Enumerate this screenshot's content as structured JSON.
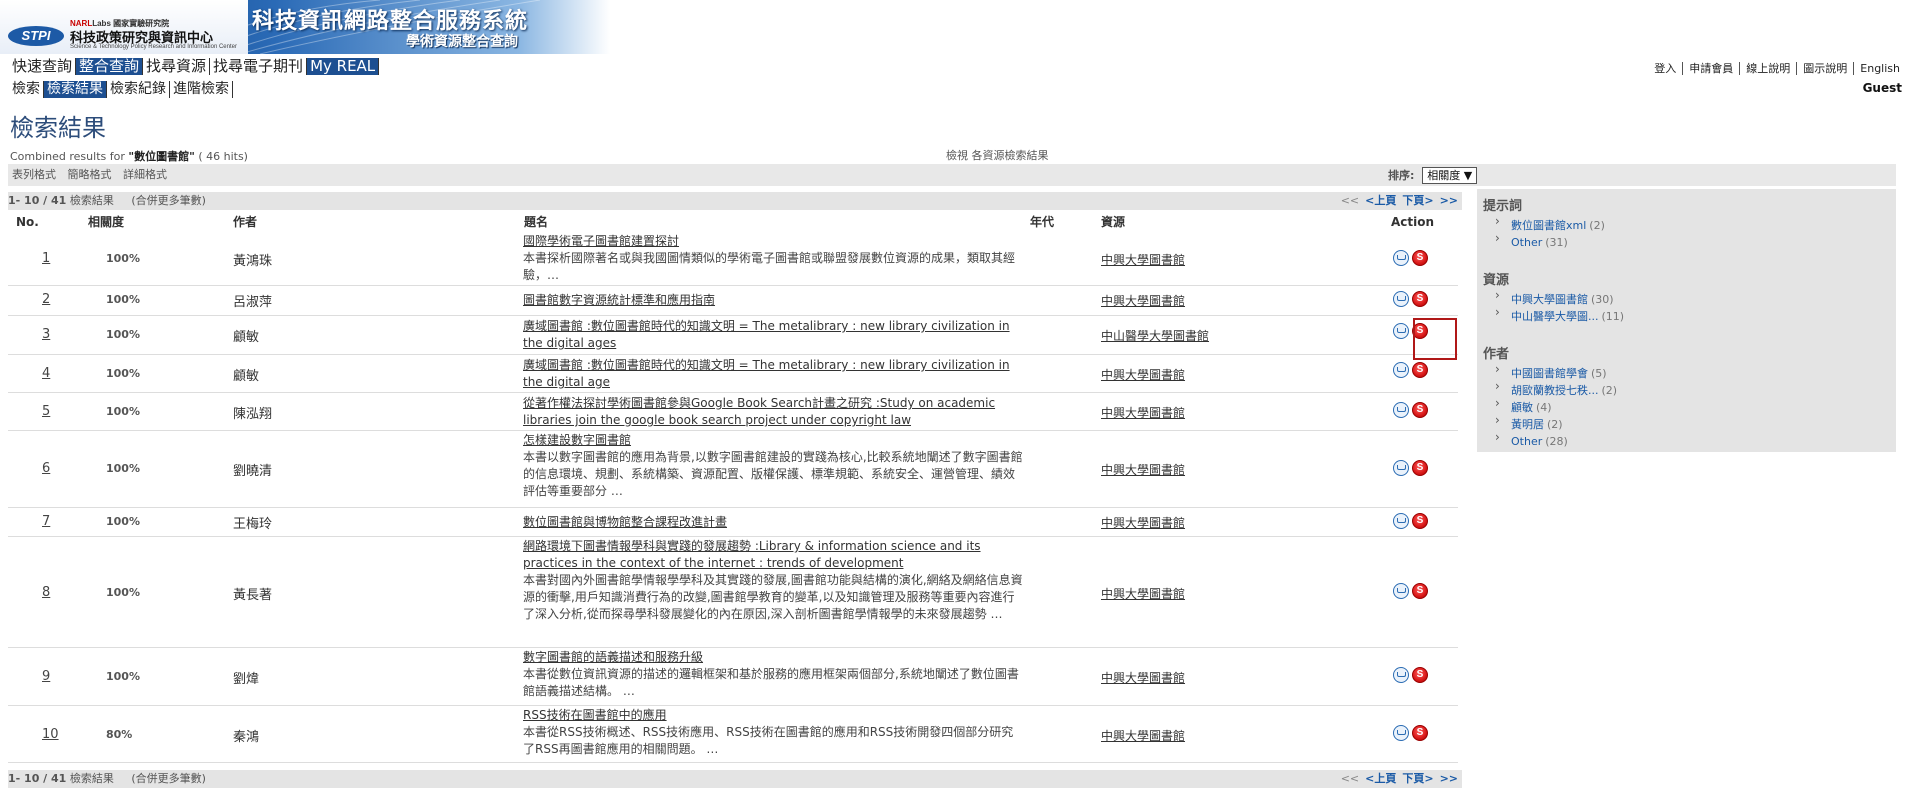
{
  "banner": {
    "narl_prefix": "NARL",
    "narl_suffix": "Labs 國家實驗研究院",
    "logo_text": "STPI",
    "institute_name": "科技政策研究與資訊中心",
    "institute_en": "Science & Technology Policy Research and Information Center",
    "title": "科技資訊網路整合服務系統",
    "subtitle": "學術資源整合查詢"
  },
  "nav_primary": [
    {
      "label": "快速查詢",
      "active": false
    },
    {
      "label": "整合查詢",
      "active": true
    },
    {
      "label": "找尋資源",
      "active": false
    },
    {
      "label": "找尋電子期刊",
      "active": false
    },
    {
      "label": "My REAL",
      "active": true
    }
  ],
  "nav_secondary": [
    {
      "label": "檢索",
      "active": false
    },
    {
      "label": "檢索結果",
      "active": true
    },
    {
      "label": "檢索紀錄",
      "active": false
    },
    {
      "label": "進階檢索",
      "active": false
    }
  ],
  "top_links": [
    "登入",
    "申請會員",
    "線上說明",
    "圖示說明",
    "English"
  ],
  "user": "Guest",
  "page_title": "檢索結果",
  "combined": {
    "prefix": "Combined results for ",
    "query": "\"數位圖書館\"",
    "hits": " ( 46 hits)"
  },
  "view_all": {
    "label": "檢視 ",
    "link": "各資源檢索結果"
  },
  "formats": [
    "表列格式",
    "簡略格式",
    "詳細格式"
  ],
  "sort": {
    "label": "排序:",
    "value": "相關度 ▼"
  },
  "pager": {
    "count": "1- 10 / 41",
    "label": " 檢索結果",
    "more": "合併更多筆數",
    "first": "<<",
    "prev": "<上頁",
    "next": "下頁>",
    "last": ">>"
  },
  "columns": {
    "no": "No.",
    "relevance": "相關度",
    "author": "作者",
    "title": "題名",
    "year": "年代",
    "source": "資源",
    "action": "Action"
  },
  "results": [
    {
      "no": "1",
      "rel": "100%",
      "author": "黃鴻珠",
      "title": "國際學術電子圖書館建置探討",
      "desc": "本書探析國際著名或與我國圖情類似的學術電子圖書館或聯盟發展數位資源的成果，類取其經驗，…",
      "source": "中興大學圖書館"
    },
    {
      "no": "2",
      "rel": "100%",
      "author": "呂淑萍",
      "title": "圖書館數字資源統計標準和應用指南",
      "desc": "",
      "source": "中興大學圖書館"
    },
    {
      "no": "3",
      "rel": "100%",
      "author": "顧敏",
      "title": "廣域圖書館 :數位圖書館時代的知識文明 = The metalibrary : new library civilization in the digital ages",
      "desc": "",
      "source": "中山醫學大學圖書館"
    },
    {
      "no": "4",
      "rel": "100%",
      "author": "顧敏",
      "title": "廣域圖書館 :數位圖書館時代的知識文明 = The metalibrary : new library civilization in the digital age",
      "desc": "",
      "source": "中興大學圖書館"
    },
    {
      "no": "5",
      "rel": "100%",
      "author": "陳泓翔",
      "title": "從著作權法探討學術圖書館參與Google Book Search計畫之研究 :Study on academic libraries join the google book search project under copyright law",
      "desc": "",
      "source": "中興大學圖書館"
    },
    {
      "no": "6",
      "rel": "100%",
      "author": "劉曉清",
      "title": "怎樣建設數字圖書館",
      "desc": "本書以數字圖書館的應用為背景,以數字圖書館建設的實踐為核心,比較系統地闡述了數字圖書館的信息環境、規劃、系統構築、資源配置、版權保護、標準規範、系統安全、運營管理、績效評估等重要部分 …",
      "source": "中興大學圖書館"
    },
    {
      "no": "7",
      "rel": "100%",
      "author": "王梅玲",
      "title": "數位圖書館與博物館整合課程改進計畫",
      "desc": "",
      "source": "中興大學圖書館"
    },
    {
      "no": "8",
      "rel": "100%",
      "author": "黃長著",
      "title": "網路環境下圖書情報學科與實踐的發展趨勢 :Library & information science and its practices in the context of the internet : trends of development",
      "desc": "本書對國內外圖書館學情報學學科及其實踐的發展,圖書館功能與結構的演化,網絡及網絡信息資源的衝擊,用戶知識消費行為的改變,圖書館學教育的變革,以及知識管理及服務等重要內容進行了深入分析,從而探尋學科發展變化的內在原因,深入剖析圖書館學情報學的未來發展趨勢 …",
      "source": "中興大學圖書館"
    },
    {
      "no": "9",
      "rel": "100%",
      "author": "劉煒",
      "title": "數字圖書館的語義描述和服務升級",
      "desc": "本書從數位資訊資源的描述的邏輯框架和基於服務的應用框架兩個部分,系統地闡述了數位圖書館語義描述結構。 …",
      "source": "中興大學圖書館"
    },
    {
      "no": "10",
      "rel": "80%",
      "author": "秦鴻",
      "title": "RSS技術在圖書館中的應用",
      "desc": "本書從RSS技術概述、RSS技術應用、RSS技術在圖書館的應用和RSS技術開發四個部分研究了RSS再圖書館應用的相關問題。 …",
      "source": "中興大學圖書館"
    }
  ],
  "facets": [
    {
      "title": "提示詞",
      "items": [
        {
          "label": "數位圖書館xml",
          "count": "(2)"
        },
        {
          "label": "Other",
          "count": "(31)"
        }
      ]
    },
    {
      "title": "資源",
      "items": [
        {
          "label": "中興大學圖書館",
          "count": "(30)"
        },
        {
          "label": "中山醫學大學圖...",
          "count": "(11)"
        }
      ]
    },
    {
      "title": "作者",
      "items": [
        {
          "label": "中國圖書館學會",
          "count": "(5)"
        },
        {
          "label": "胡歐蘭教授七秩...",
          "count": "(2)"
        },
        {
          "label": "顧敏",
          "count": "(4)"
        },
        {
          "label": "黃明居",
          "count": "(2)"
        },
        {
          "label": "Other",
          "count": "(28)"
        }
      ]
    }
  ],
  "icons": {
    "cart": "cart-icon",
    "sfx": "sfx-link-icon"
  },
  "colors": {
    "nav_active": "#1d4f91",
    "link_blue": "#1a5aa6",
    "highlight": "#b01818"
  }
}
